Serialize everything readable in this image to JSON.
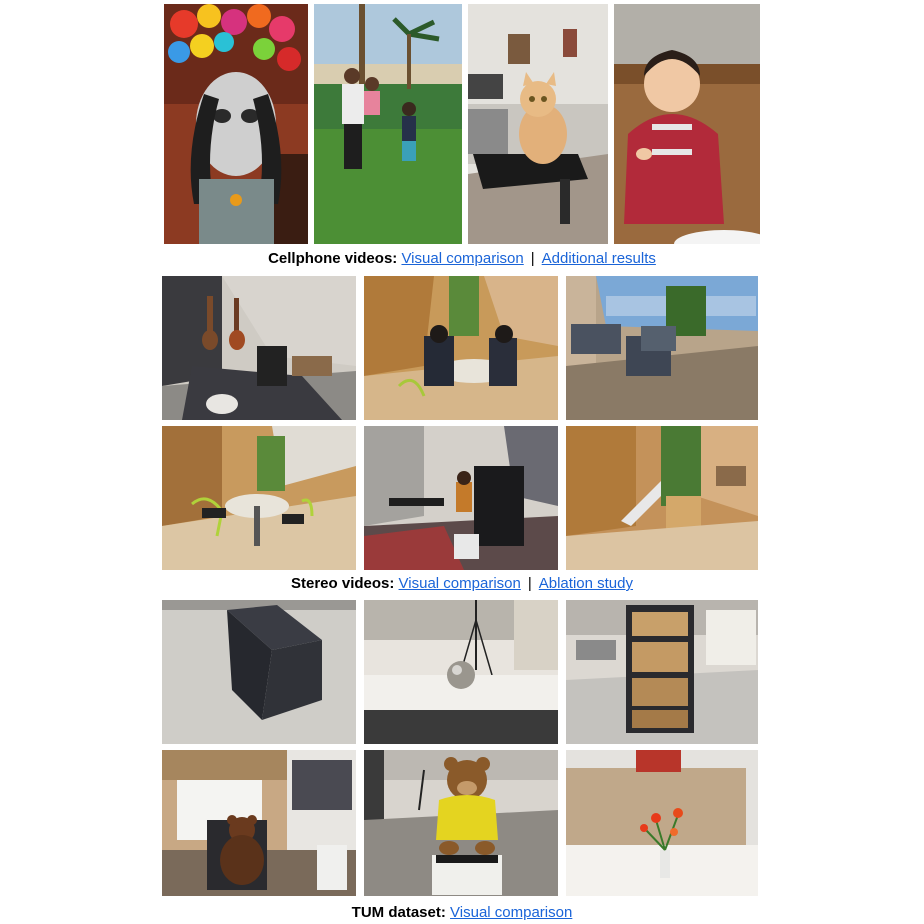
{
  "sections": [
    {
      "label": "Cellphone videos:",
      "links": [
        "Visual comparison",
        "Additional results"
      ]
    },
    {
      "label": "Stereo videos:",
      "links": [
        "Visual comparison",
        "Ablation study"
      ]
    },
    {
      "label": "TUM dataset:",
      "links": [
        "Visual comparison"
      ]
    }
  ],
  "separator": "|"
}
